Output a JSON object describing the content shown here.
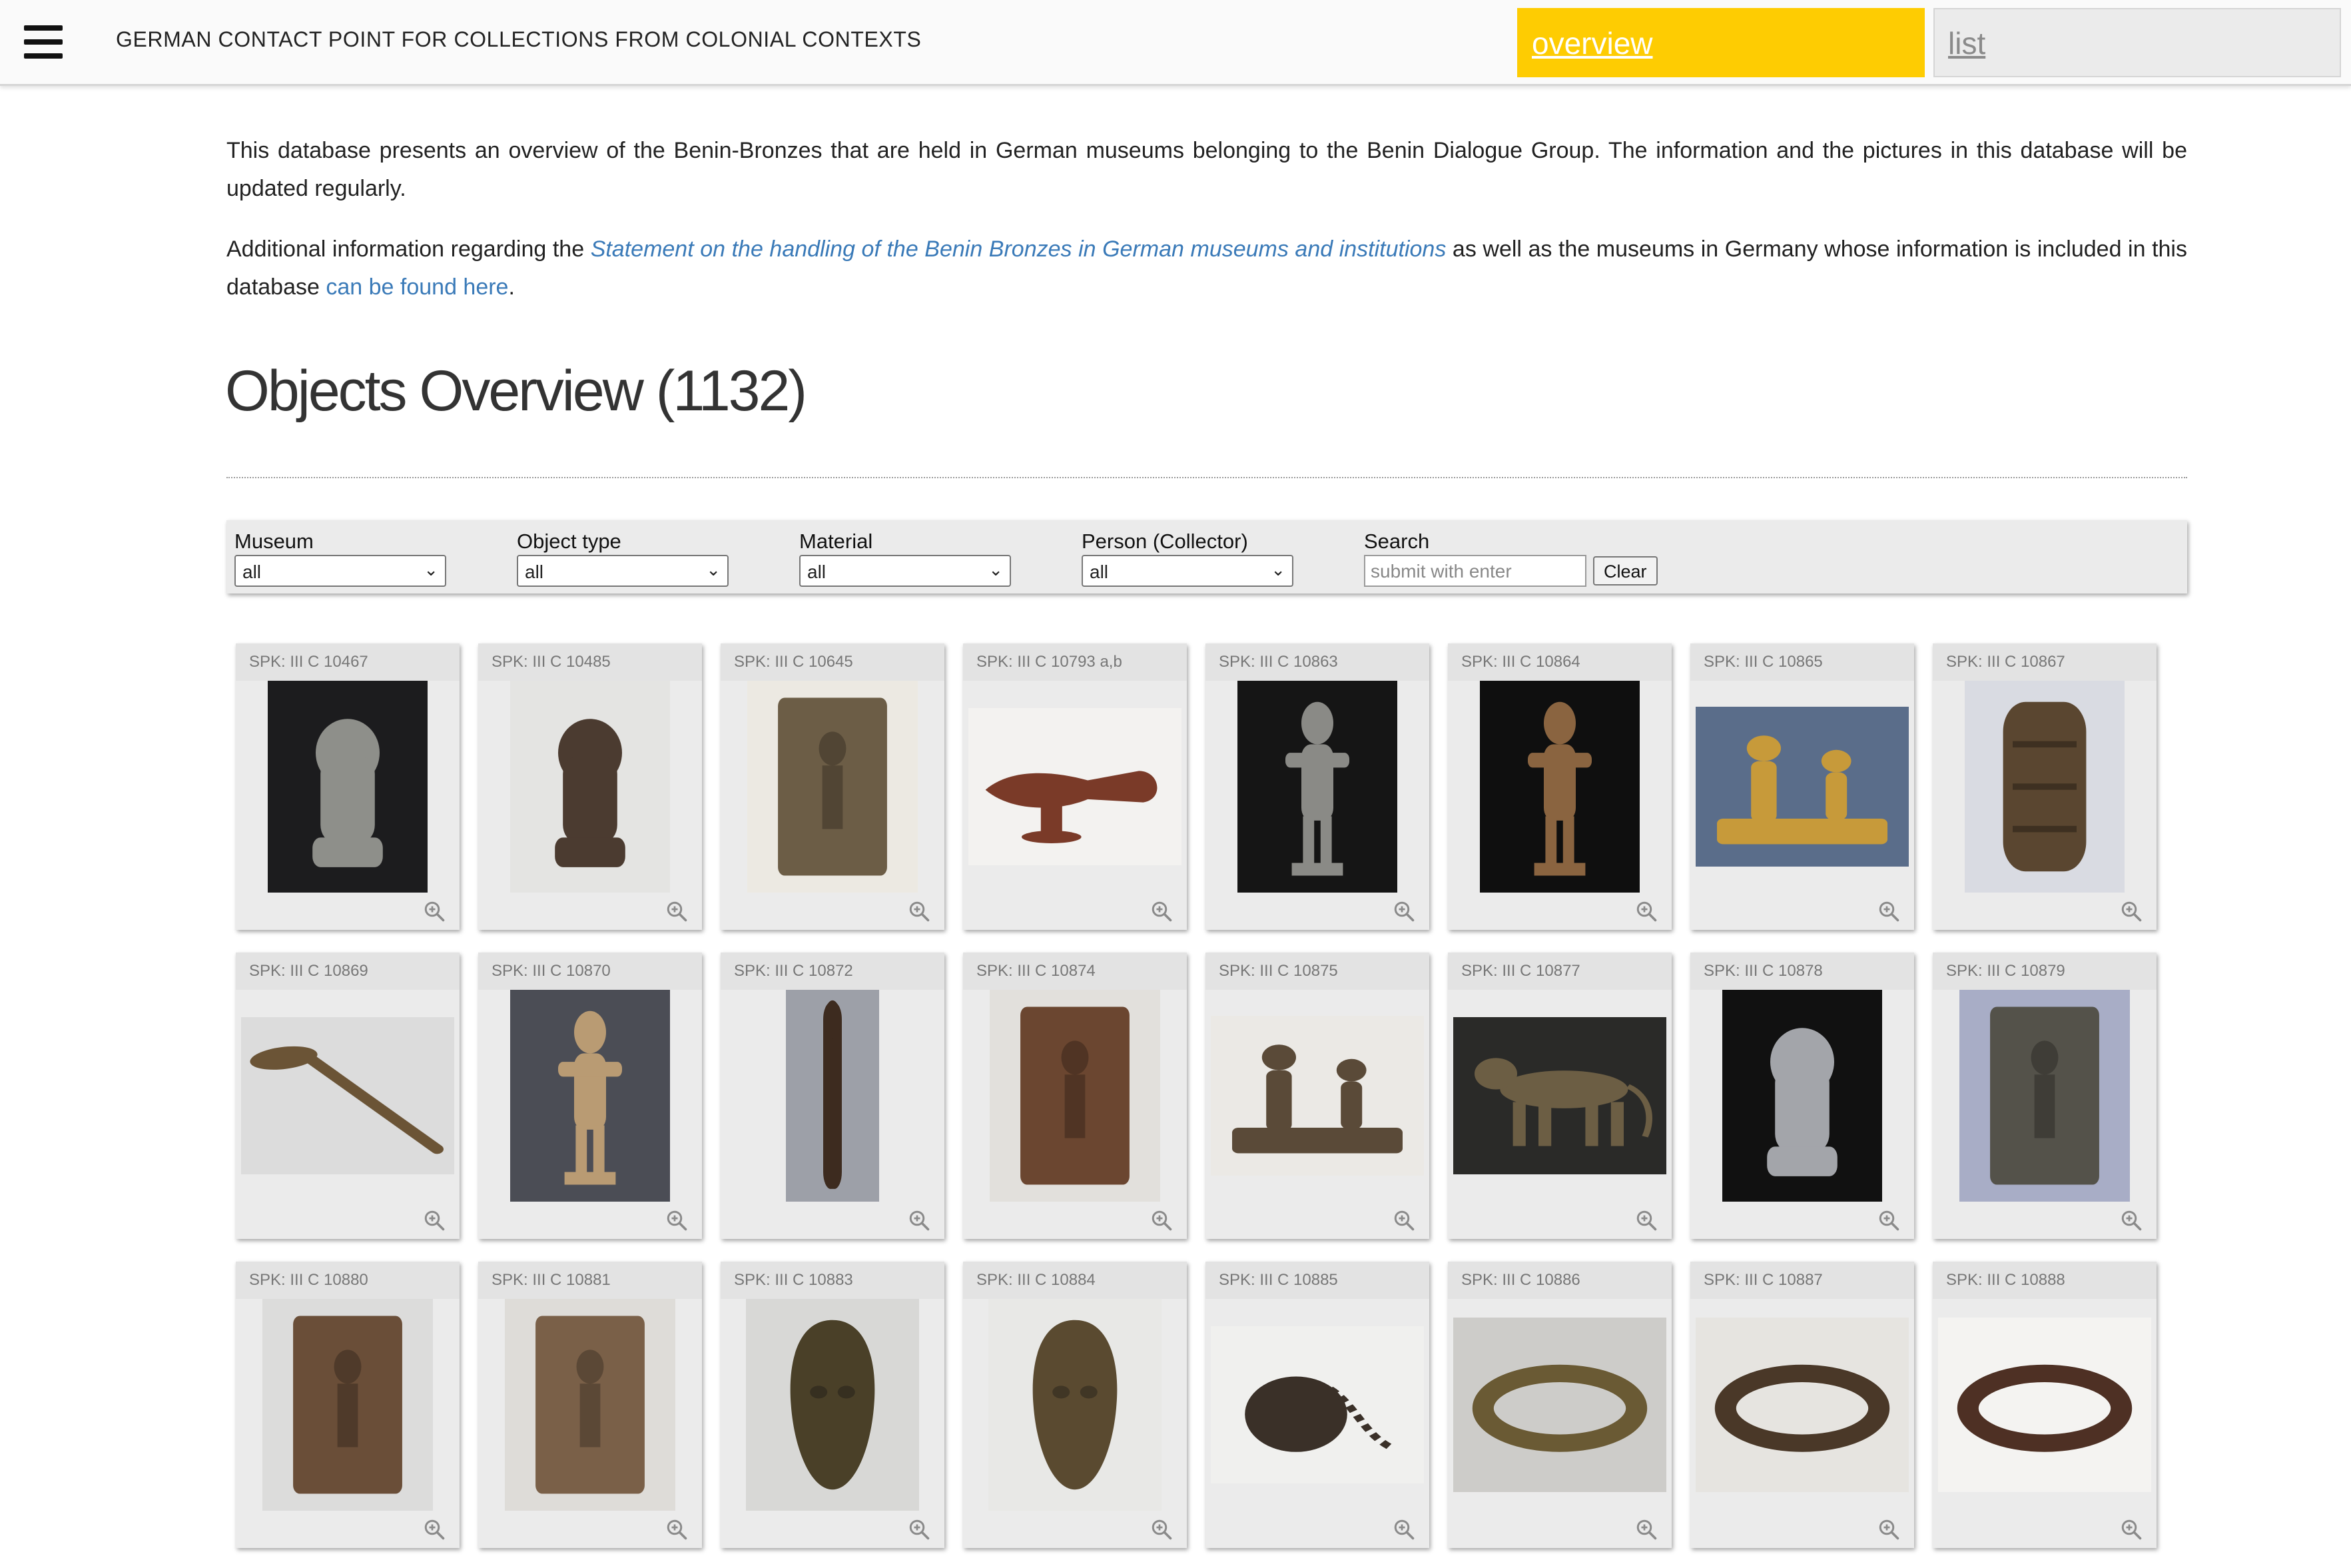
{
  "header": {
    "site_title": "GERMAN CONTACT POINT FOR COLLECTIONS FROM COLONIAL CONTEXTS",
    "nav": {
      "overview": "overview",
      "list": "list"
    },
    "colors": {
      "accent": "#fecc02",
      "link": "#3a7ab8"
    }
  },
  "intro": {
    "p1": "This database presents an overview of the Benin-Bronzes that are held in German museums belonging to the Benin Dialogue Group. The information and the pictures in this database will be updated regularly.",
    "p2_before": "Additional information regarding the ",
    "p2_statement_link": "Statement on the handling of the Benin Bronzes in German museums and institutions",
    "p2_middle": " as well as the museums in Germany whose information is included in this database ",
    "p2_found_link": "can be found here",
    "p2_after": "."
  },
  "heading": "Objects Overview (1132)",
  "filters": {
    "museum": {
      "label": "Museum",
      "value": "all"
    },
    "object_type": {
      "label": "Object type",
      "value": "all"
    },
    "material": {
      "label": "Material",
      "value": "all"
    },
    "person": {
      "label": "Person (Collector)",
      "value": "all"
    },
    "search": {
      "label": "Search",
      "placeholder": "submit with enter",
      "clear_label": "Clear"
    }
  },
  "objects": [
    {
      "label": "SPK: III C 10467",
      "icon": "zoom-icon",
      "image": {
        "bg": "#1c1c1e",
        "fg": "#8e8f8a",
        "shape": "head"
      }
    },
    {
      "label": "SPK: III C 10485",
      "icon": "zoom-icon",
      "image": {
        "bg": "#e4e4e2",
        "fg": "#4b3b30",
        "shape": "head"
      }
    },
    {
      "label": "SPK: III C 10645",
      "icon": "zoom-icon",
      "image": {
        "bg": "#ece9e2",
        "fg": "#6c5d46",
        "shape": "plaque"
      }
    },
    {
      "label": "SPK: III C 10793 a,b",
      "icon": "zoom-icon",
      "image": {
        "bg": "#f3f2f0",
        "fg": "#7a3a28",
        "shape": "horizontal"
      }
    },
    {
      "label": "SPK: III C 10863",
      "icon": "zoom-icon",
      "image": {
        "bg": "#151515",
        "fg": "#8a8a86",
        "shape": "figure"
      }
    },
    {
      "label": "SPK: III C 10864",
      "icon": "zoom-icon",
      "image": {
        "bg": "#0f0f0f",
        "fg": "#8a6440",
        "shape": "figure"
      }
    },
    {
      "label": "SPK: III C 10865",
      "icon": "zoom-icon",
      "image": {
        "bg": "#5a6d8a",
        "fg": "#c79a3a",
        "shape": "group"
      }
    },
    {
      "label": "SPK: III C 10867",
      "icon": "zoom-icon",
      "image": {
        "bg": "#d9dbe2",
        "fg": "#5a4630",
        "shape": "cylinder"
      }
    },
    {
      "label": "SPK: III C 10869",
      "icon": "zoom-icon",
      "image": {
        "bg": "#dcdcdc",
        "fg": "#6b5436",
        "shape": "spoon"
      }
    },
    {
      "label": "SPK: III C 10870",
      "icon": "zoom-icon",
      "image": {
        "bg": "#4b4d55",
        "fg": "#b99b73",
        "shape": "figure"
      }
    },
    {
      "label": "SPK: III C 10872",
      "icon": "zoom-icon",
      "image": {
        "bg": "#9da0a8",
        "fg": "#3d2b1f",
        "shape": "staff"
      }
    },
    {
      "label": "SPK: III C 10874",
      "icon": "zoom-icon",
      "image": {
        "bg": "#e2e0dc",
        "fg": "#6b4630",
        "shape": "plaque"
      }
    },
    {
      "label": "SPK: III C 10875",
      "icon": "zoom-icon",
      "image": {
        "bg": "#ebe9e5",
        "fg": "#5a4a38",
        "shape": "group"
      }
    },
    {
      "label": "SPK: III C 10877",
      "icon": "zoom-icon",
      "image": {
        "bg": "#2a2a28",
        "fg": "#6c5e44",
        "shape": "animal"
      }
    },
    {
      "label": "SPK: III C 10878",
      "icon": "zoom-icon",
      "image": {
        "bg": "#111111",
        "fg": "#a3a5aa",
        "shape": "head"
      }
    },
    {
      "label": "SPK: III C 10879",
      "icon": "zoom-icon",
      "image": {
        "bg": "#a8adc6",
        "fg": "#54524a",
        "shape": "plaque"
      }
    },
    {
      "label": "SPK: III C 10880",
      "icon": "zoom-icon",
      "image": {
        "bg": "#dcdcdb",
        "fg": "#6a4e38",
        "shape": "plaque"
      }
    },
    {
      "label": "SPK: III C 10881",
      "icon": "zoom-icon",
      "image": {
        "bg": "#dedcd8",
        "fg": "#7a6048",
        "shape": "plaque"
      }
    },
    {
      "label": "SPK: III C 10883",
      "icon": "zoom-icon",
      "image": {
        "bg": "#d8d8d6",
        "fg": "#4a4028",
        "shape": "mask"
      }
    },
    {
      "label": "SPK: III C 10884",
      "icon": "zoom-icon",
      "image": {
        "bg": "#e8e8e6",
        "fg": "#5a4a30",
        "shape": "mask"
      }
    },
    {
      "label": "SPK: III C 10885",
      "icon": "zoom-icon",
      "image": {
        "bg": "#f0f0ee",
        "fg": "#3a3028",
        "shape": "ball"
      }
    },
    {
      "label": "SPK: III C 10886",
      "icon": "zoom-icon",
      "image": {
        "bg": "#cdccc9",
        "fg": "#6a5a34",
        "shape": "ring"
      }
    },
    {
      "label": "SPK: III C 10887",
      "icon": "zoom-icon",
      "image": {
        "bg": "#e6e4e0",
        "fg": "#4a3828",
        "shape": "ring"
      }
    },
    {
      "label": "SPK: III C 10888",
      "icon": "zoom-icon",
      "image": {
        "bg": "#f4f3f1",
        "fg": "#4e3024",
        "shape": "ring"
      }
    }
  ]
}
